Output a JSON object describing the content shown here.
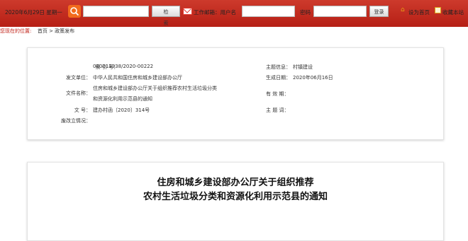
{
  "header": {
    "date": "2020年6月29日 星期一",
    "search_placeholder": "",
    "search_button": "检 索",
    "mail_label": "工作邮箱：用户名",
    "password_label": "密码",
    "login_button": "登录",
    "set_home": "设为首页",
    "add_favorite": "收藏本站",
    "brand_color": "#bf2318"
  },
  "breadcrumb": {
    "lead": "您现在的位置:",
    "home": "首页",
    "separator": ">",
    "current": "政策发布"
  },
  "info": {
    "index_label": "索 引 号：",
    "index_value": "000013338/2020-00222",
    "topic_label": "主题信息：",
    "topic_value": "村镇建设",
    "issuer_label": "发文单位：",
    "issuer_value": "中华人民共和国住房和城乡建设部办公厅",
    "date_label": "生成日期：",
    "date_value": "2020年06月16日",
    "name_label": "文件名称：",
    "name_line1": "住房和城乡建设部办公厅关于组织推荐农村生活垃圾分类",
    "name_line2": "和资源化利用示范县的通知",
    "validity_label": "有 效 期：",
    "validity_value": "",
    "doc_label": "文 号：",
    "doc_value": "建办村函〔2020〕314号",
    "keyword_label": "主 题 词：",
    "keyword_value": "",
    "origin_label": "废改立情况：",
    "origin_value": ""
  },
  "article": {
    "title_line1": "住房和城乡建设部办公厅关于组织推荐",
    "title_line2": "农村生活垃圾分类和资源化利用示范县的通知"
  }
}
